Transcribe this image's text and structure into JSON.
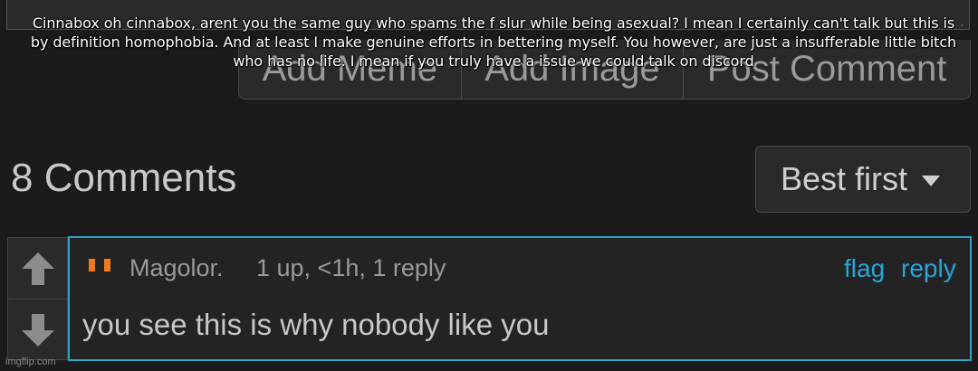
{
  "caption": "Cinnabox oh cinnabox, arent you the same guy who spams the f slur while being asexual? I mean I certainly can't talk but this is by definition homophobia. And at least I make genuine efforts in bettering myself. You however, are just a insufferable little bitch who has no life. I mean if you truly have a issue we could talk on discord",
  "buttons": {
    "add_meme": "Add Meme",
    "add_image": "Add Image",
    "post_comment": "Post Comment"
  },
  "comments": {
    "count_label": "8 Comments",
    "sort": {
      "selected": "Best first"
    },
    "items": [
      {
        "author": "Magolor.",
        "meta": "1 up, <1h, 1 reply",
        "flag": "flag",
        "reply": "reply",
        "text": "you see this is why nobody like you"
      }
    ]
  },
  "watermark": "imgflip.com",
  "colors": {
    "background": "#1b1b1c",
    "accent": "#2da3c7",
    "link": "#27a6d9",
    "quote": "#f07a1a"
  },
  "icons": [
    "upvote-arrow-icon",
    "downvote-arrow-icon",
    "quote-icon",
    "caret-down-icon",
    "resize-grip-icon"
  ]
}
